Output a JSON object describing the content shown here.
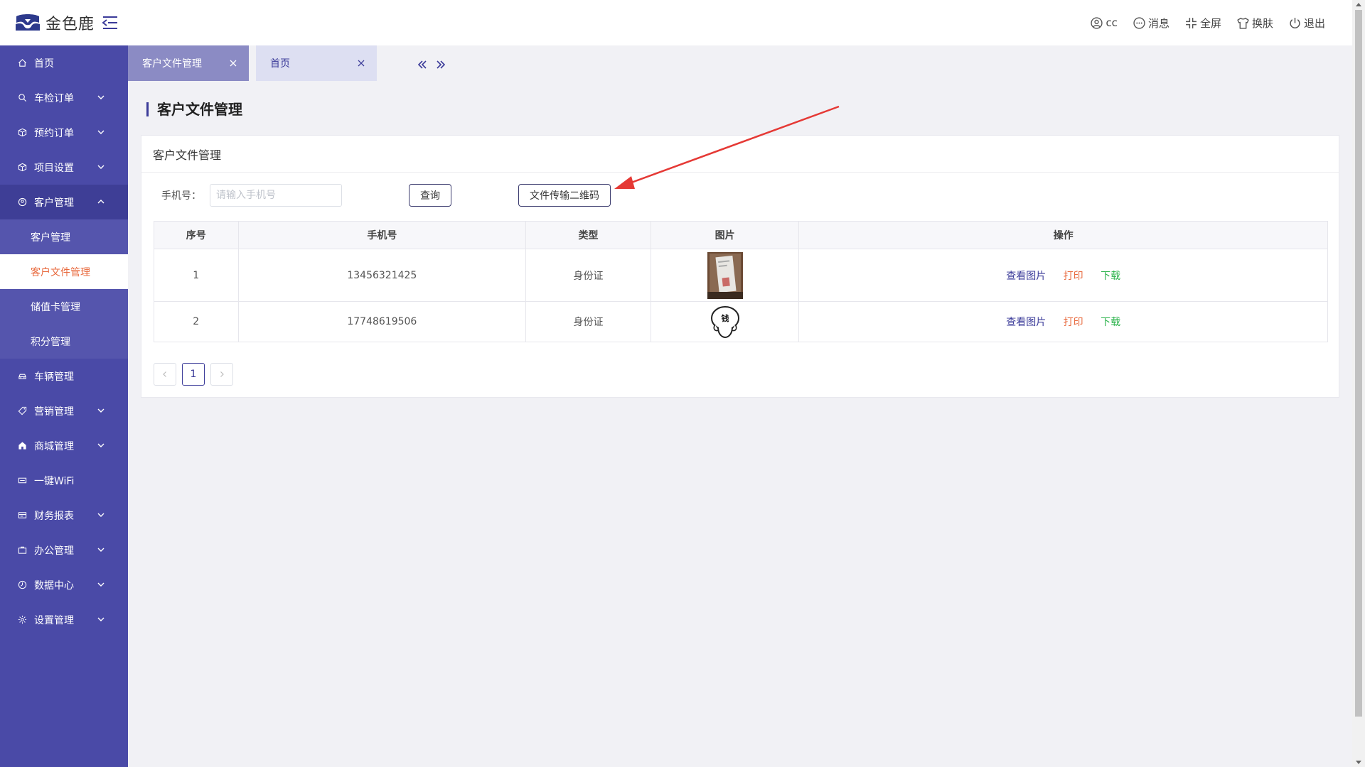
{
  "app": {
    "logo_text": "金色鹿",
    "brand_color": "#4a4aa7",
    "accent_color": "#e8693d"
  },
  "header": {
    "items": [
      {
        "label": "cc",
        "icon": "user-icon"
      },
      {
        "label": "消息",
        "icon": "message-icon"
      },
      {
        "label": "全屏",
        "icon": "fullscreen-icon"
      },
      {
        "label": "换肤",
        "icon": "shirt-icon"
      },
      {
        "label": "退出",
        "icon": "power-icon"
      }
    ]
  },
  "sidebar": {
    "items": [
      {
        "label": "首页",
        "icon": "home-icon"
      },
      {
        "label": "车检订单",
        "icon": "search-icon"
      },
      {
        "label": "预约订单",
        "icon": "box-icon"
      },
      {
        "label": "项目设置",
        "icon": "box-icon"
      },
      {
        "label": "客户管理",
        "icon": "user-circle-icon"
      },
      {
        "label": "车辆管理",
        "icon": "car-icon"
      },
      {
        "label": "营销管理",
        "icon": "tag-icon"
      },
      {
        "label": "商城管理",
        "icon": "shop-icon"
      },
      {
        "label": "一键WiFi",
        "icon": "wifi-icon"
      },
      {
        "label": "财务报表",
        "icon": "report-icon"
      },
      {
        "label": "办公管理",
        "icon": "briefcase-icon"
      },
      {
        "label": "数据中心",
        "icon": "clock-icon"
      },
      {
        "label": "设置管理",
        "icon": "gear-icon"
      }
    ],
    "customer_sub": [
      "客户管理",
      "客户文件管理",
      "储值卡管理",
      "积分管理"
    ]
  },
  "tabs": [
    {
      "label": "客户文件管理"
    },
    {
      "label": "首页"
    }
  ],
  "page": {
    "title": "客户文件管理",
    "card_title": "客户文件管理",
    "search": {
      "label": "手机号：",
      "placeholder": "请输入手机号",
      "value": ""
    },
    "query_button": "查询",
    "qr_button": "文件传输二维码"
  },
  "table": {
    "headers": [
      "序号",
      "手机号",
      "类型",
      "图片",
      "操作"
    ],
    "rows": [
      {
        "index": "1",
        "phone": "13456321425",
        "type": "身份证",
        "image": "id-card-photo",
        "actions": [
          "查看图片",
          "打印",
          "下载"
        ]
      },
      {
        "index": "2",
        "phone": "17748619506",
        "type": "身份证",
        "image": "cartoon-sticker",
        "sticker_text": "钱",
        "actions": [
          "查看图片",
          "打印",
          "下载"
        ]
      }
    ]
  },
  "pagination": {
    "current": "1"
  }
}
